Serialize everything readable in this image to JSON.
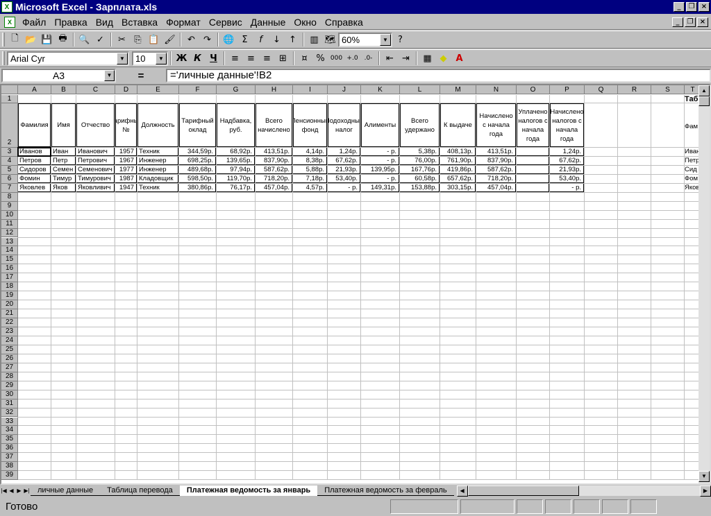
{
  "window": {
    "title": "Microsoft Excel - Зарплата.xls",
    "app_icon": "X"
  },
  "menu": [
    "Файл",
    "Правка",
    "Вид",
    "Вставка",
    "Формат",
    "Сервис",
    "Данные",
    "Окно",
    "Справка"
  ],
  "toolbar": {
    "zoom": "60%"
  },
  "format": {
    "font": "Arial Cyr",
    "size": "10",
    "bold": "Ж",
    "italic": "К",
    "underline": "Ч",
    "percent": "%",
    "thousands": "000"
  },
  "formula": {
    "namebox": "A3",
    "eq": "=",
    "text": "='личные данные'!B2"
  },
  "columns": [
    "A",
    "B",
    "C",
    "D",
    "E",
    "F",
    "G",
    "H",
    "I",
    "J",
    "K",
    "L",
    "M",
    "N",
    "O",
    "P",
    "Q",
    "R",
    "S",
    "T"
  ],
  "headers": [
    "Фамилия",
    "Имя",
    "Отчество",
    "Тарифный №",
    "Должность",
    "Тарифный оклад",
    "Надбавка, руб.",
    "Всего начислено",
    "Пенсионный фонд",
    "Подоходный налог",
    "Алименты",
    "Всего удержано",
    "К выдаче",
    "Начислено с начала года",
    "Уплачено налогов с начала года",
    "Начислено налогов с начала года"
  ],
  "rows": [
    [
      "Иванов",
      "Иван",
      "Иванович",
      "1957",
      "Техник",
      "344,59р.",
      "68,92р.",
      "413,51р.",
      "4,14р.",
      "1,24р.",
      "-   р.",
      "5,38р.",
      "408,13р.",
      "413,51р.",
      "",
      "1,24р."
    ],
    [
      "Петров",
      "Петр",
      "Петрович",
      "1967",
      "Инженер",
      "698,25р.",
      "139,65р.",
      "837,90р.",
      "8,38р.",
      "67,62р.",
      "-   р.",
      "76,00р.",
      "761,90р.",
      "837,90р.",
      "",
      "67,62р."
    ],
    [
      "Сидоров",
      "Семен",
      "Семенович",
      "1977",
      "Инженер",
      "489,68р.",
      "97,94р.",
      "587,62р.",
      "5,88р.",
      "21,93р.",
      "139,95р.",
      "167,76р.",
      "419,86р.",
      "587,62р.",
      "",
      "21,93р."
    ],
    [
      "Фомин",
      "Тимур",
      "Тимурович",
      "1987",
      "Кладовщик",
      "598,50р.",
      "119,70р.",
      "718,20р.",
      "7,18р.",
      "53,40р.",
      "-   р.",
      "60,58р.",
      "657,62р.",
      "718,20р.",
      "",
      "53,40р."
    ],
    [
      "Яковлев",
      "Яков",
      "Яковливич",
      "1947",
      "Техник",
      "380,86р.",
      "76,17р.",
      "457,04р.",
      "4,57р.",
      "-   р.",
      "149,31р.",
      "153,88р.",
      "303,15р.",
      "457,04р.",
      "",
      "-   р."
    ]
  ],
  "col_t": {
    "title": "Таб",
    "header": "Фам",
    "values": [
      "Иван",
      "Петр",
      "Сид",
      "Фом",
      "Яков"
    ]
  },
  "sheets": [
    "личные данные",
    "Таблица перевода",
    "Платежная ведомость за январь",
    "Платежная ведомость за  февраль"
  ],
  "status": "Готово"
}
